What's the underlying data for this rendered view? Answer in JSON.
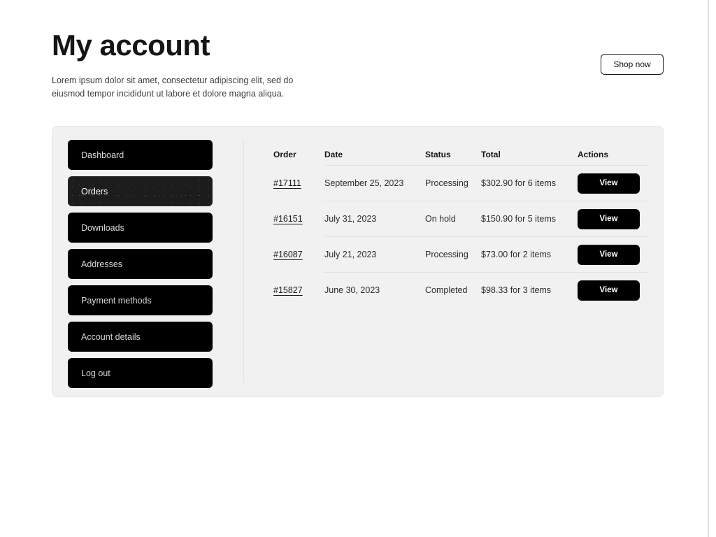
{
  "header": {
    "title": "My account",
    "subtitle": "Lorem ipsum dolor sit amet, consectetur adipiscing elit, sed do eiusmod tempor incididunt ut labore et dolore magna aliqua.",
    "shop_now_label": "Shop now"
  },
  "colors": {
    "page_background": "#ffffff",
    "card_background": "#f1f1f1",
    "nav_item_background": "#000000",
    "nav_item_active_background": "#1c1c1c",
    "accent": "#000000",
    "text": "#151515",
    "divider": "#e3e3e3"
  },
  "sidebar": {
    "active_item": "Orders",
    "items": [
      {
        "label": "Dashboard",
        "active": false
      },
      {
        "label": "Orders",
        "active": true
      },
      {
        "label": "Downloads",
        "active": false
      },
      {
        "label": "Addresses",
        "active": false
      },
      {
        "label": "Payment methods",
        "active": false
      },
      {
        "label": "Account details",
        "active": false
      },
      {
        "label": "Log out",
        "active": false
      }
    ]
  },
  "orders_table": {
    "columns": [
      "Order",
      "Date",
      "Status",
      "Total",
      "Actions"
    ],
    "action_label": "View",
    "rows": [
      {
        "order": "#17111",
        "date": "September 25, 2023",
        "status": "Processing",
        "total": "$302.90 for 6 items",
        "action": "View"
      },
      {
        "order": "#16151",
        "date": "July 31, 2023",
        "status": "On hold",
        "total": "$150.90 for 5 items",
        "action": "View"
      },
      {
        "order": "#16087",
        "date": "July 21, 2023",
        "status": "Processing",
        "total": "$73.00 for 2 items",
        "action": "View"
      },
      {
        "order": "#15827",
        "date": "June 30, 2023",
        "status": "Completed",
        "total": "$98.33 for 3 items",
        "action": "View"
      }
    ]
  }
}
